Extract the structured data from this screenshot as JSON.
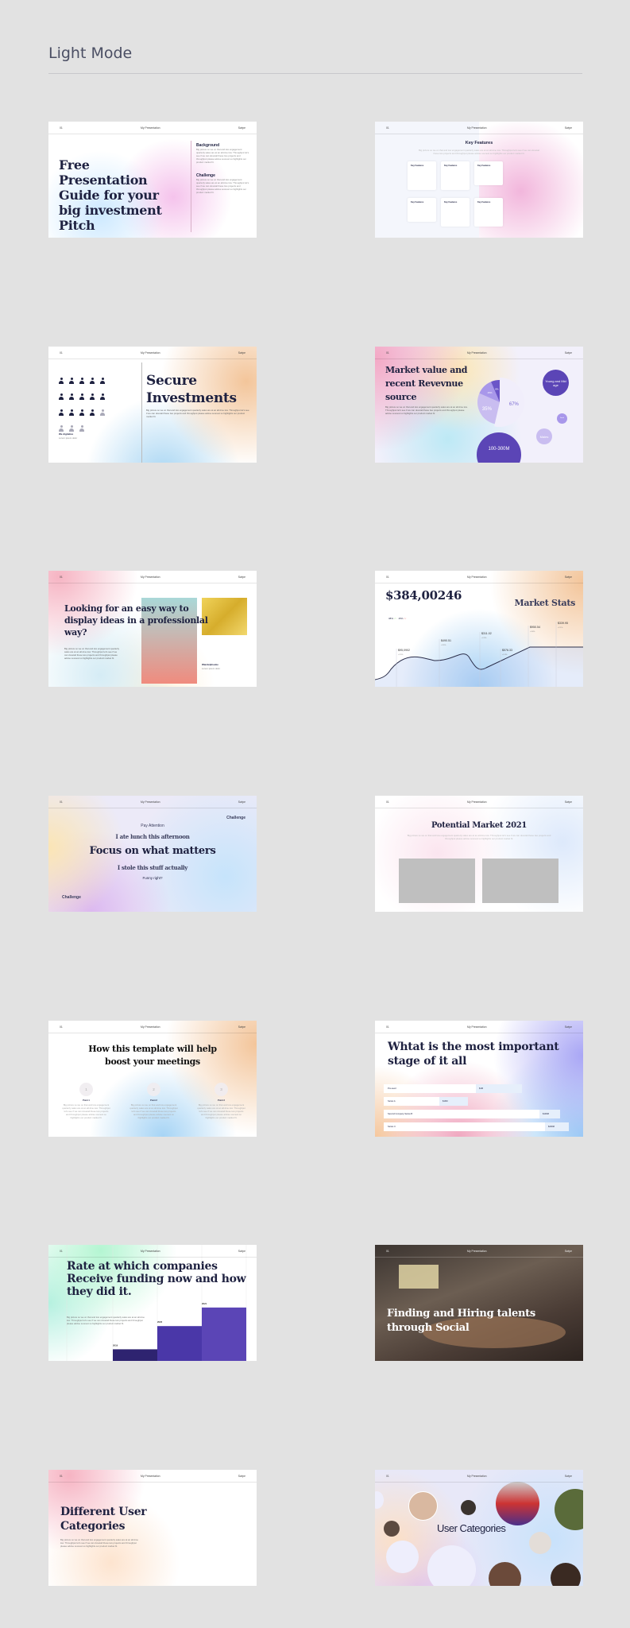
{
  "page": {
    "title": "Light Mode"
  },
  "header": {
    "num": "01",
    "title": "My Presentation",
    "right": "Swipe"
  },
  "body_text": "Big picture so we on that and low engagement quarterly sales are at an all-time low. Throughput let's see if we can dovetail these two projects and throughput please advise soonest so highlights our product market fit.",
  "slides": [
    {
      "title": "Free Presentation Guide for your big investment Pitch",
      "side": [
        {
          "h": "Background"
        },
        {
          "h": "Challenge"
        }
      ]
    },
    {
      "title": "Key Features",
      "card_title": "Key Features"
    },
    {
      "title": "Secure Investments",
      "caption": "We digitalize",
      "caption_sub": "Lorem ipsum dolor",
      "people_total": 18,
      "people_filled": 14
    },
    {
      "title": "Market value and recent Revevnue source",
      "pie": [
        {
          "label": "67%",
          "value": 67
        },
        {
          "label": "35%",
          "value": 35
        },
        {
          "label": "15%",
          "value": 15
        },
        {
          "label": "8%",
          "value": 8
        }
      ],
      "bubbles": [
        "Young and Mid age",
        "Males",
        "100-300M",
        "Female"
      ],
      "colors": {
        "dark": "#5b45b6",
        "light": "#c9bdf0"
      }
    },
    {
      "title": "Looking for an easy way to display ideas in a professionlal way?",
      "caption": "Wandelpheeke",
      "caption_sub": "Lorem ipsum dolor"
    },
    {
      "title": "$384,00246",
      "subtitle": "Market Stats",
      "stat1": "38%",
      "stat2": "15%",
      "points": [
        {
          "value": "$95,0902",
          "sub": "+2.5%"
        },
        {
          "value": "$490.51",
          "sub": "+3.5%"
        },
        {
          "value": "$311.02",
          "sub": "+2.3%"
        },
        {
          "value": "$576.33",
          "sub": "+1.9%"
        },
        {
          "value": "$950.54",
          "sub": "+3.8%"
        },
        {
          "value": "$339.95",
          "sub": "+2.1%"
        }
      ]
    },
    {
      "kicker": "Pay Attention",
      "line1": "I ate lunch this afternoon",
      "main": "Focus on what matters",
      "line2": "I stole this stuff actually",
      "line3": "Funny right?",
      "side": "Challenge"
    },
    {
      "title": "Potential Market 2021"
    },
    {
      "title": "How this template will help boost your meetings",
      "steps": [
        {
          "n": "1",
          "label": "Point 1"
        },
        {
          "n": "2",
          "label": "Point 2"
        },
        {
          "n": "3",
          "label": "Point 3"
        }
      ]
    },
    {
      "title": "Whtat is the most important stage of it all",
      "rows": [
        {
          "label": "Pre-seed",
          "value": "$1M"
        },
        {
          "label": "Series A",
          "value": "$10M"
        },
        {
          "label": "Second Company Series B",
          "value": "$100M"
        },
        {
          "label": "Series C",
          "value": "$200M"
        }
      ]
    },
    {
      "title": "Rate at which companies Receive funding now and how they did it.",
      "bars": [
        {
          "year": "2019",
          "value": 1
        },
        {
          "year": "2020",
          "value": 3
        },
        {
          "year": "2021",
          "value": 4.6
        }
      ],
      "bar_colors": [
        "#2e2370",
        "#4a37a8",
        "#5b45b6"
      ]
    },
    {
      "title": "Finding and Hiring talents through Social"
    },
    {
      "title": "Different User Categories"
    },
    {
      "title": "User Categories"
    }
  ]
}
